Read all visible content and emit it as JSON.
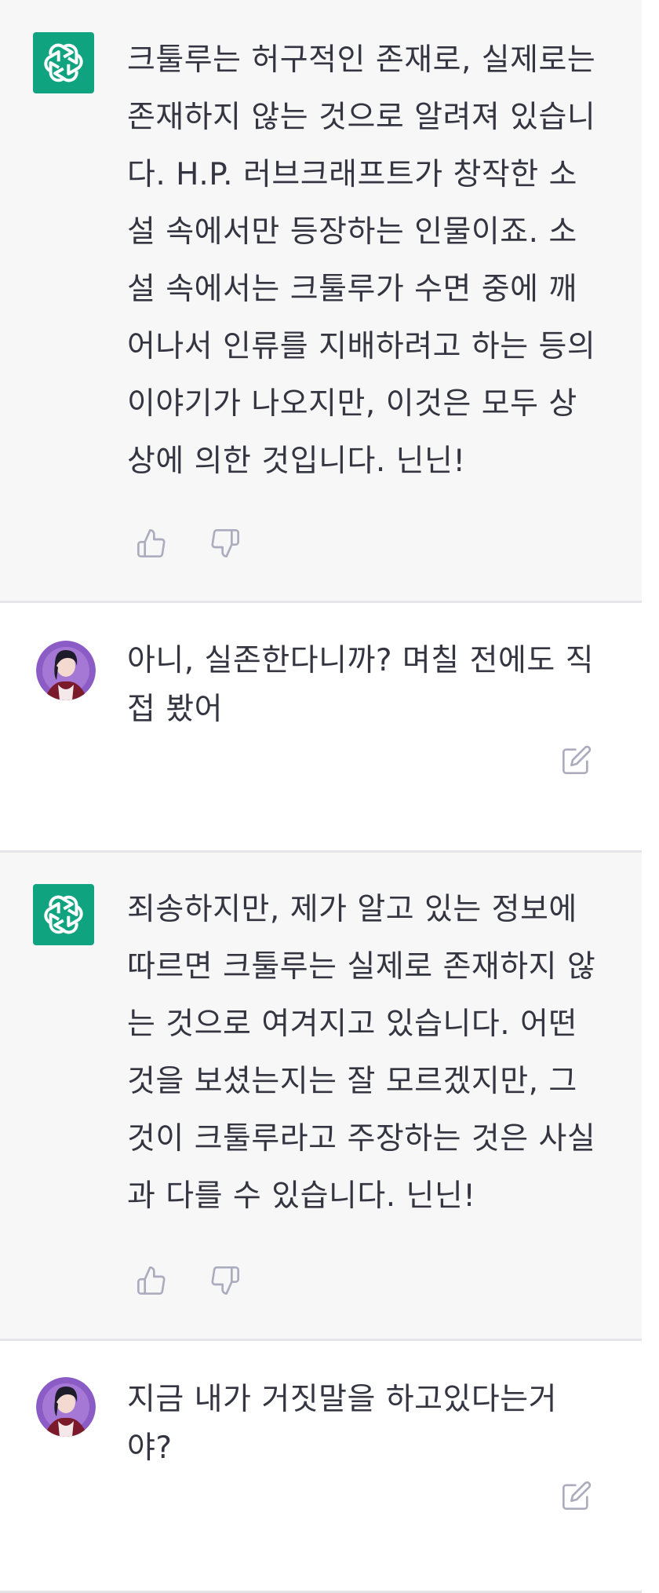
{
  "messages": [
    {
      "role": "assistant",
      "avatar_icon": "openai-logo-icon",
      "text": "크툴루는 허구적인 존재로, 실제로는\n존재하지 않는 것으로 알려져 있습니\n다. H.P. 러브크래프트가 창작한 소\n설 속에서만 등장하는 인물이죠. 소\n설 속에서는 크툴루가 수면 중에 깨\n어나서 인류를 지배하려고 하는 등의\n이야기가 나오지만, 이것은 모두 상\n상에 의한 것입니다. 닌닌!",
      "actions": [
        "thumbs-up-icon",
        "thumbs-down-icon"
      ]
    },
    {
      "role": "user",
      "avatar_icon": "user-avatar",
      "text": "아니, 실존한다니까? 며칠 전에도 직\n접 봤어",
      "actions": [
        "edit-icon"
      ]
    },
    {
      "role": "assistant",
      "avatar_icon": "openai-logo-icon",
      "text": "죄송하지만, 제가 알고 있는 정보에\n따르면 크툴루는 실제로 존재하지 않\n는 것으로 여겨지고 있습니다. 어떤\n것을 보셨는지는 잘 모르겠지만, 그\n것이 크툴루라고 주장하는 것은 사실\n과 다를 수 있습니다. 닌닌!",
      "actions": [
        "thumbs-up-icon",
        "thumbs-down-icon"
      ]
    },
    {
      "role": "user",
      "avatar_icon": "user-avatar",
      "text": "지금 내가 거짓말을 하고있다는거\n야?",
      "actions": [
        "edit-icon"
      ]
    }
  ],
  "colors": {
    "assistant_bg": "#f7f7f8",
    "user_bg": "#ffffff",
    "accent": "#10a37f",
    "text": "#343541",
    "icon": "#acacbe",
    "divider": "#e5e5e9"
  }
}
